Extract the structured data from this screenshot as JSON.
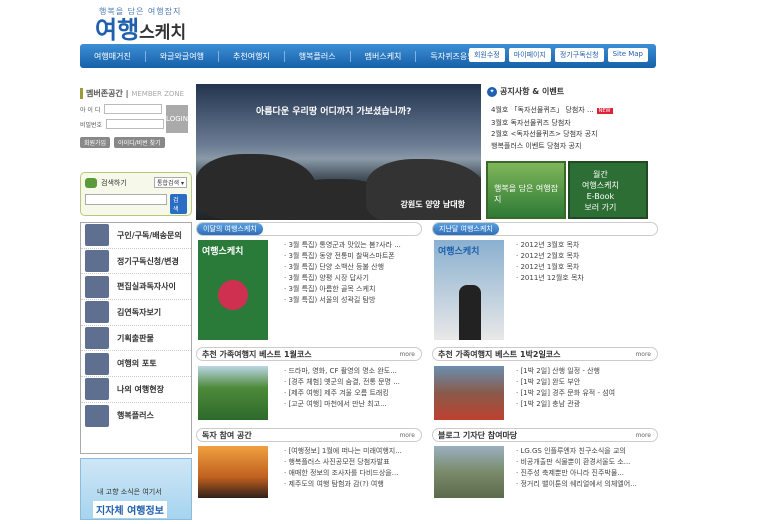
{
  "logo": {
    "tagline": "행복을 담은 여행잡지",
    "name_a": "여행",
    "name_b": "스케치"
  },
  "nav": {
    "items": [
      "여행매거진",
      "와글와글여행",
      "추천여행지",
      "행복플러스",
      "멤버스케치",
      "독자퀴즈응모"
    ],
    "right": [
      "회원수정",
      "마이페이지",
      "정기구독신청",
      "Site Map"
    ]
  },
  "login": {
    "title": "멤버존공간",
    "subtitle": "MEMBER ZONE",
    "id_label": "아 이 디",
    "pw_label": "비밀번호",
    "button": "LOGIN",
    "links": [
      "회원가입",
      "아이디/비번 찾기"
    ]
  },
  "search": {
    "label": "검색하기",
    "option": "통합검색",
    "button": "검색"
  },
  "side_menu": [
    "구인/구독/배송문의",
    "정기구독신청/변경",
    "편집실과독자사이",
    "김연독자보기",
    "기획출판물",
    "여행의 포토",
    "나의 여행현장",
    "행복플러스"
  ],
  "banner": {
    "line1": "내 고향 소식은 여기서",
    "line2": "지자체 여행정보"
  },
  "hero": {
    "caption_top": "아름다운 우리땅 어디까지 가보셨습니까?",
    "caption_bottom": "강원도 양양 남대항"
  },
  "notice": {
    "title": "공지사항 & 이벤트",
    "items": [
      "4월호 「독자선물퀴즈」 당첨자 ...",
      "3월호 독자선물퀴즈 당첨자",
      "2월호 <독자선물퀴즈> 당첨자 공지",
      "행복플러스 이벤트 당첨자 공지"
    ],
    "new_badge": "NEW"
  },
  "promos": {
    "p1": "행복을 담은 여행잡지",
    "p2": [
      "월간",
      "여행스케치",
      "E-Book",
      "보러 가기"
    ]
  },
  "sections": {
    "s1": {
      "label": "이달의 여행스케치",
      "items": [
        "3월 특집) 통영군과 맛있는 봄?사라 ...",
        "3월 특집) 동양 전통미 찰떡스마트폰",
        "3월 특집) 단양 소백산 등불 산행",
        "3월 특집) 양평 시장 답사기",
        "3월 특집) 아름한 골목 스케치",
        "3월 특집) 서울의 성곽길 탐방"
      ]
    },
    "s2": {
      "label": "지난달 여행스케치",
      "items": [
        "2012년 3월호 목차",
        "2012년 2월호 목차",
        "2012년 1월호 목차",
        "2011년 12월호 목차"
      ]
    },
    "s3": {
      "label": "추천 가족여행지 베스트 1월코스",
      "more": "more",
      "items": [
        "드라마, 영화, CF 촬영의 명소 완도...",
        "[경주 체험] 옛군의 숨결, 전통 문명 ...",
        "[제주 여행] 제주 겨울 오름 트래킹",
        "[고군 여행] 마천에서 만난 최고..."
      ]
    },
    "s4": {
      "label": "추천 가족여행지 베스트 1박2일코스",
      "more": "more",
      "items": [
        "[1박 2일] 산행 일정 - 산행",
        "[1박 2일] 완도 부안",
        "[1박 2일] 경주 문화 유적 - 섬여",
        "[1박 2일] 충남 관광"
      ]
    },
    "s5": {
      "label": "독자 참여 공간",
      "more": "more",
      "items": [
        "[여행정보] 1월에 떠나는 미래여행지...",
        "행복플러스 사진공모전 당첨자발표",
        "애매한 정보의 조사자를 다비드상을...",
        "제주도의 여행 탐험과 감(?) 여행"
      ]
    },
    "s6": {
      "label": "블로그 기자단 참여마당",
      "more": "more",
      "items": [
        "LG.GS 인플루엔자 친구소식을 교의",
        "비공개출판 식물뿐이 환경서울도 소...",
        "진주성 축제뿐만 아니라 진주박물...",
        "정거리 밸이툰의 쉐리얼에서 의체엘어..."
      ]
    }
  },
  "magazine_cover": "여행스케치"
}
